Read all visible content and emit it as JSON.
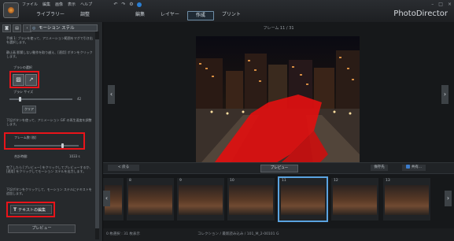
{
  "menu": [
    "ファイル",
    "編集",
    "画像",
    "表示",
    "ヘルプ"
  ],
  "modules": {
    "library": "ライブラリー",
    "adjust": "調整",
    "edit": "編集",
    "layers": "レイヤー",
    "create": "作成",
    "print": "プリント"
  },
  "brand": "PhotoDirector",
  "left_panel": {
    "title": "モーション ステル",
    "intro": "手順 1: ブラシを使って、アニメーション範囲をマグで引き出を選択します。",
    "intro2": "静止画 影響しない動作を取り越え、[適用] ボタンをクリックします。",
    "brush_select_label": "ブラシの選択",
    "brush_size_label": "ブラシ サイズ",
    "brush_size_value": "42",
    "clear_label": "クリア",
    "step2_text": "下記ボタンを使って、アニメーション GIF の再生速度を調整します。",
    "frame_count_label": "フレーム数 (枚)",
    "total_time_label": "合計時間:",
    "total_time_value": "1033 s",
    "step3_text": "完了したら [プレビュー] をクリックしてプレビューするか、[適用] をクリックしてモーション ステルを出力します。",
    "step4_text": "下記ボタンをクリックして、モーション ステルにテキストを追加します。",
    "text_edit_button": "テキストの編集",
    "preview_button": "プレビュー"
  },
  "main": {
    "frame_label": "フレーム 11 / 31",
    "back_button": "< 戻る",
    "preview_button": "プレビュー",
    "save_button": "保存先",
    "share_button": "共有...",
    "thumbnails": [
      {
        "num": "",
        "selected": false
      },
      {
        "num": "8",
        "selected": false
      },
      {
        "num": "9",
        "selected": false
      },
      {
        "num": "10",
        "selected": false
      },
      {
        "num": "11",
        "selected": true
      },
      {
        "num": "12",
        "selected": false
      },
      {
        "num": "13",
        "selected": false
      }
    ],
    "status_left": "0 枚選択 : 31 枚表示",
    "status_mid": "コレクション / 最新読み込み / 101_M_2-00101 G"
  },
  "colors": {
    "highlight_red": "#e8141a",
    "selection_blue": "#5aa3e0",
    "mask_red": "#e01010"
  }
}
